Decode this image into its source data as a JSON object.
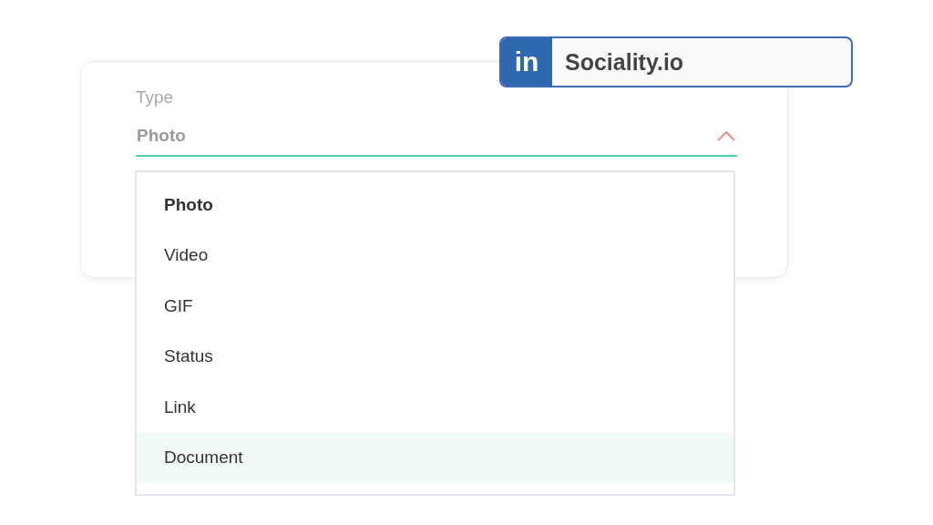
{
  "account_badge": {
    "logo": "in",
    "name": "Sociality.io"
  },
  "type_field": {
    "label": "Type",
    "value": "Photo",
    "expanded": true
  },
  "dropdown": {
    "options": [
      {
        "label": "Photo",
        "selected": true,
        "highlighted": false
      },
      {
        "label": "Video",
        "selected": false,
        "highlighted": false
      },
      {
        "label": "GIF",
        "selected": false,
        "highlighted": false
      },
      {
        "label": "Status",
        "selected": false,
        "highlighted": false
      },
      {
        "label": "Link",
        "selected": false,
        "highlighted": false
      },
      {
        "label": "Document",
        "selected": false,
        "highlighted": true
      }
    ]
  }
}
